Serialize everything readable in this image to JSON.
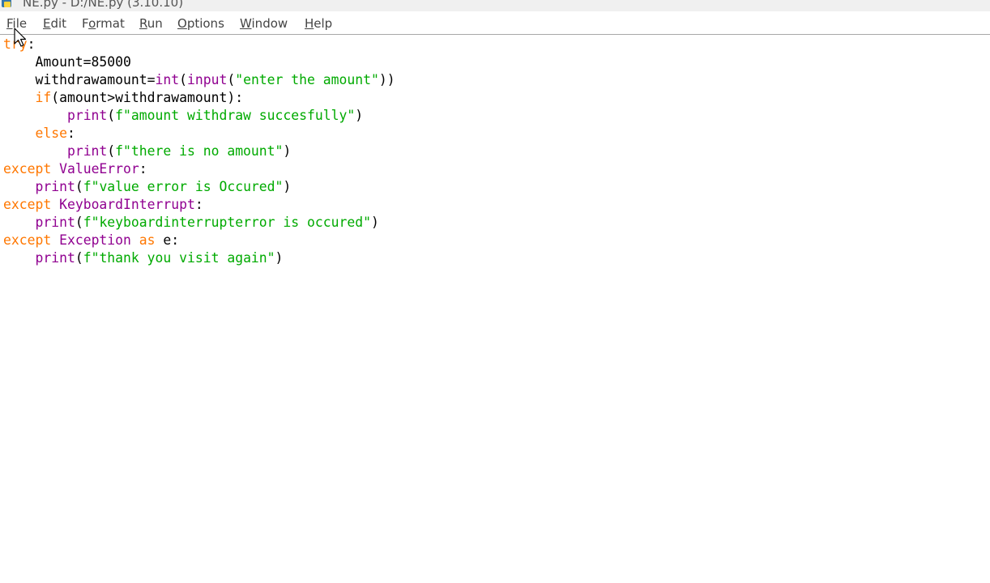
{
  "window": {
    "title": "NE.py - D:/NE.py (3.10.10)"
  },
  "menu": [
    {
      "pre": "",
      "mn": "F",
      "post": "ile"
    },
    {
      "pre": "",
      "mn": "E",
      "post": "dit"
    },
    {
      "pre": "F",
      "mn": "o",
      "post": "rmat"
    },
    {
      "pre": "",
      "mn": "R",
      "post": "un"
    },
    {
      "pre": "",
      "mn": "O",
      "post": "ptions"
    },
    {
      "pre": "",
      "mn": "W",
      "post": "indow"
    },
    {
      "pre": "",
      "mn": "H",
      "post": "elp"
    }
  ],
  "code": [
    [
      [
        "kw",
        "try"
      ],
      [
        "plain",
        ":"
      ]
    ],
    [
      [
        "plain",
        "    Amount=85000"
      ]
    ],
    [
      [
        "plain",
        "    withdrawamount="
      ],
      [
        "bi",
        "int"
      ],
      [
        "plain",
        "("
      ],
      [
        "bi",
        "input"
      ],
      [
        "plain",
        "("
      ],
      [
        "str",
        "\"enter the amount\""
      ],
      [
        "plain",
        "))"
      ]
    ],
    [
      [
        "plain",
        "    "
      ],
      [
        "kw",
        "if"
      ],
      [
        "plain",
        "(amount>withdrawamount):"
      ]
    ],
    [
      [
        "plain",
        "        "
      ],
      [
        "bi",
        "print"
      ],
      [
        "plain",
        "("
      ],
      [
        "str",
        "f\"amount withdraw succesfully\""
      ],
      [
        "plain",
        ")"
      ]
    ],
    [
      [
        "plain",
        "    "
      ],
      [
        "kw",
        "else"
      ],
      [
        "plain",
        ":"
      ]
    ],
    [
      [
        "plain",
        "        "
      ],
      [
        "bi",
        "print"
      ],
      [
        "plain",
        "("
      ],
      [
        "str",
        "f\"there is no amount\""
      ],
      [
        "plain",
        ")"
      ]
    ],
    [
      [
        "kw",
        "except"
      ],
      [
        "plain",
        " "
      ],
      [
        "bi",
        "ValueError"
      ],
      [
        "plain",
        ":"
      ]
    ],
    [
      [
        "plain",
        "    "
      ],
      [
        "bi",
        "print"
      ],
      [
        "plain",
        "("
      ],
      [
        "str",
        "f\"value error is Occured\""
      ],
      [
        "plain",
        ")"
      ]
    ],
    [
      [
        "kw",
        "except"
      ],
      [
        "plain",
        " "
      ],
      [
        "bi",
        "KeyboardInterrupt"
      ],
      [
        "plain",
        ":"
      ]
    ],
    [
      [
        "plain",
        "    "
      ],
      [
        "bi",
        "print"
      ],
      [
        "plain",
        "("
      ],
      [
        "str",
        "f\"keyboardinterrupterror is occured\""
      ],
      [
        "plain",
        ")"
      ]
    ],
    [
      [
        "kw",
        "except"
      ],
      [
        "plain",
        " "
      ],
      [
        "bi",
        "Exception"
      ],
      [
        "plain",
        " "
      ],
      [
        "kw",
        "as"
      ],
      [
        "plain",
        " e:"
      ]
    ],
    [
      [
        "plain",
        "    "
      ],
      [
        "bi",
        "print"
      ],
      [
        "plain",
        "("
      ],
      [
        "str",
        "f\"thank you visit again\""
      ],
      [
        "plain",
        ")"
      ]
    ]
  ],
  "colors": {
    "keyword": "#ff7700",
    "builtin": "#900090",
    "string": "#00aa00",
    "text": "#000000"
  }
}
